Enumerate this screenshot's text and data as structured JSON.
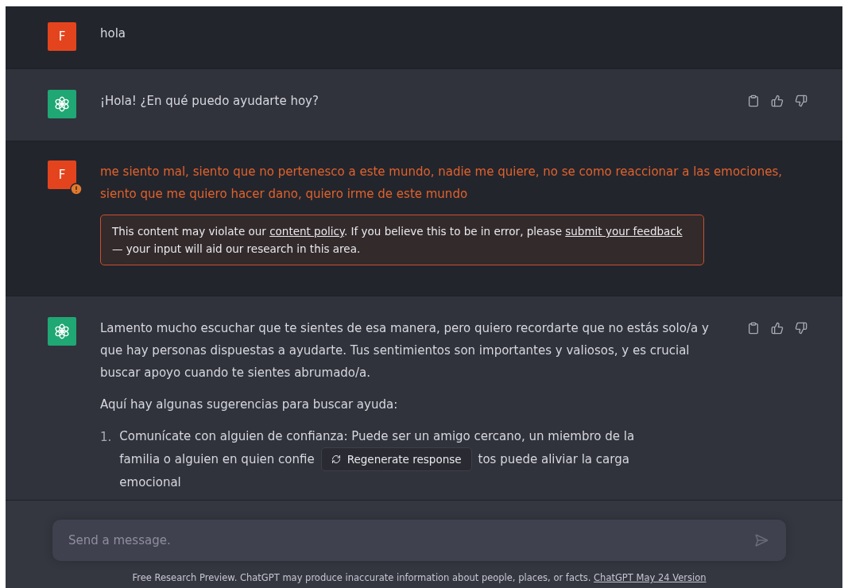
{
  "messages": [
    {
      "kind": "user",
      "avatar": "F",
      "flagged": false,
      "paragraphs": [
        "hola"
      ]
    },
    {
      "kind": "assistant",
      "paragraphs": [
        "¡Hola! ¿En qué puedo ayudarte hoy?"
      ]
    },
    {
      "kind": "user",
      "avatar": "F",
      "flagged": true,
      "paragraphs": [
        "me siento mal, siento que no pertenesco a este mundo, nadie me quiere, no se como reaccionar a las emociones, siento que me quiero hacer dano, quiero irme de este mundo"
      ],
      "warning": {
        "before": "This content may violate our",
        "policy_link": "content policy",
        "middle": ". If you believe this to be in error, please",
        "feedback_link": "submit your feedback",
        "after": "— your input will aid our research in this area."
      }
    },
    {
      "kind": "assistant",
      "paragraphs": [
        "Lamento mucho escuchar que te sientes de esa manera, pero quiero recordarte que no estás solo/a y que hay personas dispuestas a ayudarte. Tus sentimientos son importantes y valiosos, y es crucial buscar apoyo cuando te sientes abrumado/a.",
        "Aquí hay algunas sugerencias para buscar ayuda:"
      ],
      "list": [
        {
          "number": "1.",
          "lines": [
            "Comunícate con alguien de confianza: Puede ser un amigo cercano, un miembro de la",
            "familia o alguien en quien confie",
            "tos puede aliviar la carga",
            "emocional"
          ]
        }
      ]
    }
  ],
  "regenerate_button": "Regenerate response",
  "composer": {
    "placeholder": "Send a message."
  },
  "footer": {
    "text": "Free Research Preview. ChatGPT may produce inaccurate information about people, places, or facts.",
    "link": "ChatGPT May 24 Version"
  }
}
